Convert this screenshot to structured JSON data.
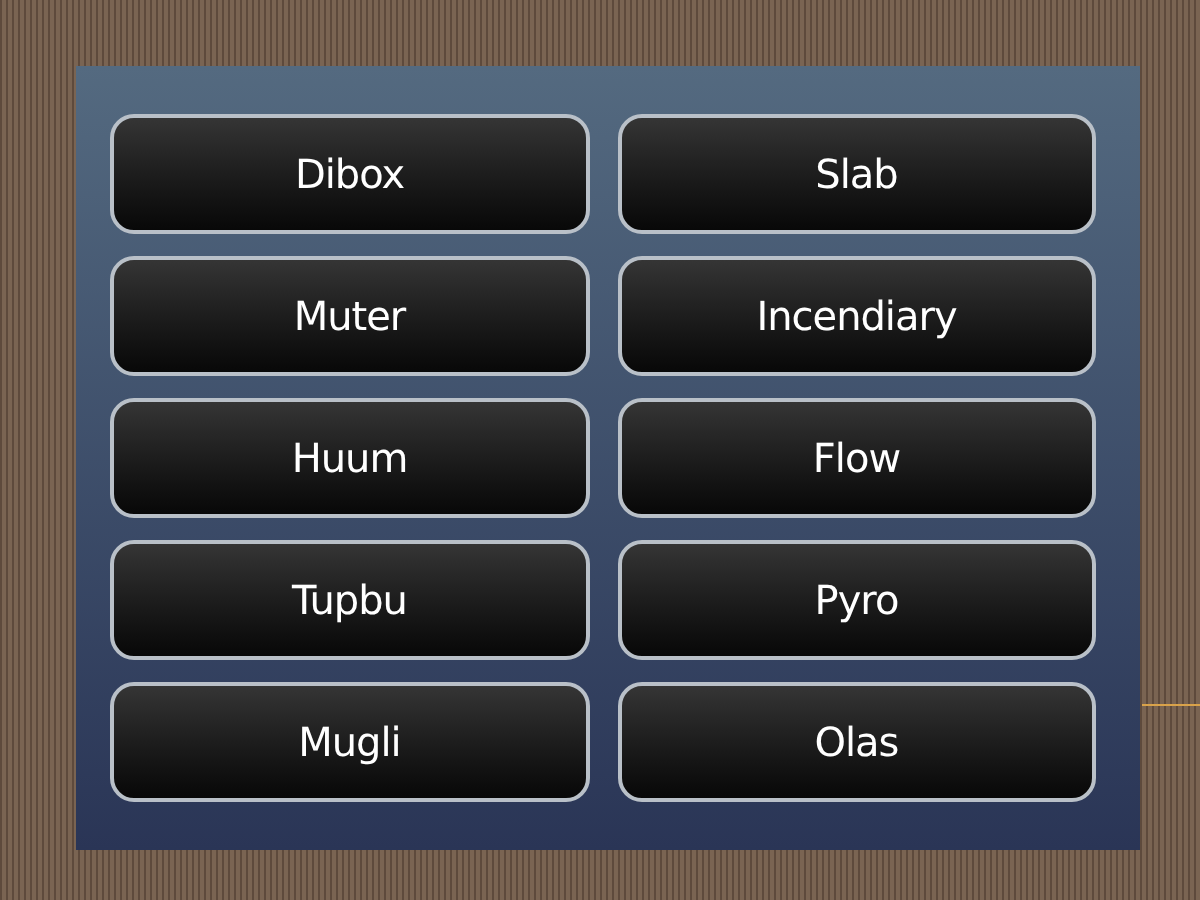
{
  "buttons": [
    {
      "label": "Dibox"
    },
    {
      "label": "Slab"
    },
    {
      "label": "Muter"
    },
    {
      "label": "Incendiary"
    },
    {
      "label": "Huum"
    },
    {
      "label": "Flow"
    },
    {
      "label": "Tupbu"
    },
    {
      "label": "Pyro"
    },
    {
      "label": "Mugli"
    },
    {
      "label": "Olas"
    }
  ]
}
